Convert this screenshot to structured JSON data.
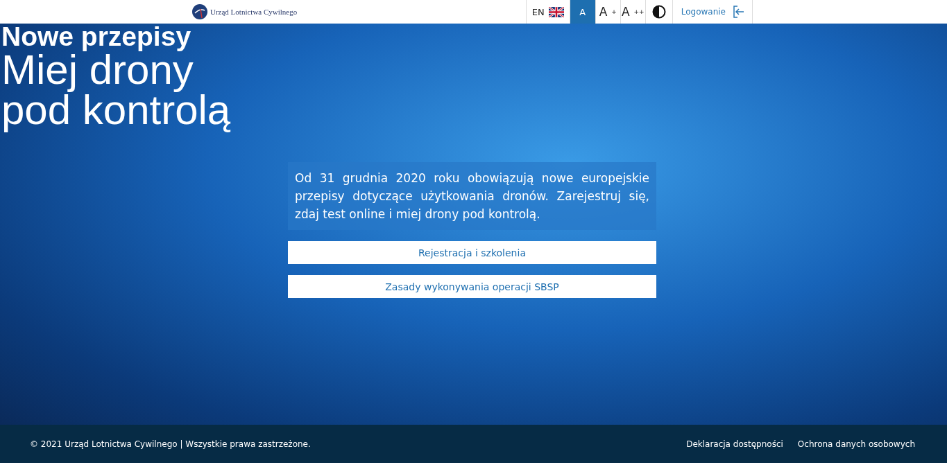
{
  "header": {
    "logo_text": "Urząd Lotnictwa Cywilnego",
    "language": "EN",
    "font_sizes": [
      {
        "label": "A",
        "selected": true
      },
      {
        "label": "A$^{+}$",
        "selected": false
      },
      {
        "label": "A$^{++}$",
        "selected": false
      }
    ],
    "login": "Logowanie"
  },
  "hero": {
    "kicker": "Nowe przepisy",
    "headline_lines": [
      "Miej drony",
      "pod kontrolą"
    ],
    "intro": "Od 31 grudnia 2020 roku obowiązują nowe europejskie przepisy dotyczące użytkowania dronów. Zarejestruj się, zdaj test online i miej drony pod kontrolą.",
    "buttons": [
      "Rejestracja i szkolenia",
      "Zasady wykonywania operacji SBSP"
    ]
  },
  "footer": {
    "copyright": "© 2021 Urząd Lotnictwa Cywilnego | Wszystkie prawa zastrzeżone.",
    "links": [
      "Deklaracja dostępności",
      "Ochrona danych osobowych"
    ]
  }
}
